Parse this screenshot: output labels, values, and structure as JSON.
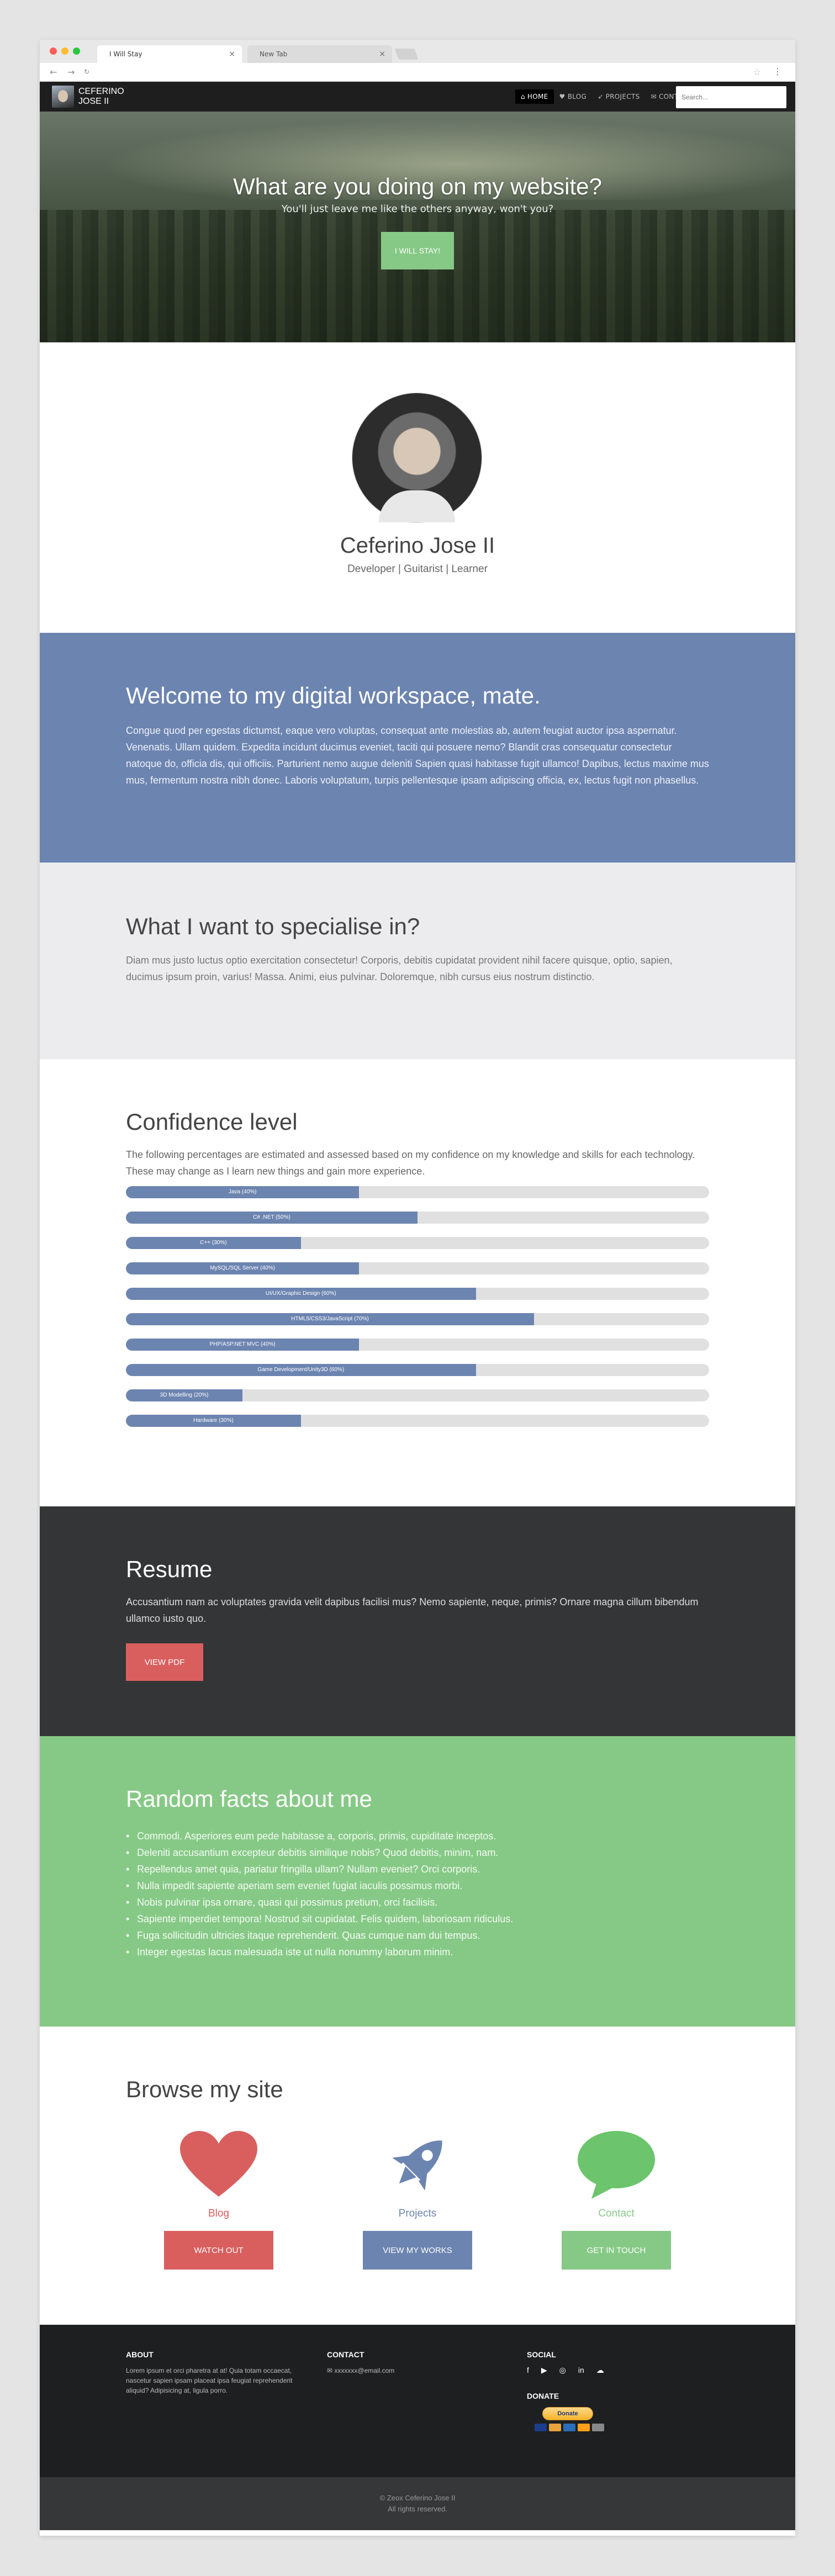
{
  "browser": {
    "tabs": [
      {
        "label": "I Will Stay",
        "active": true
      },
      {
        "label": "New Tab",
        "active": false
      }
    ],
    "tab_close": "×",
    "back": "←",
    "forward": "→",
    "reload": "↻",
    "star": "☆",
    "menu": "⋮"
  },
  "nav": {
    "brand": "CEFERINO JOSE II",
    "items": [
      {
        "label": "HOME",
        "icon": "home-icon",
        "glyph": "⌂",
        "active": true
      },
      {
        "label": "BLOG",
        "icon": "heart-icon",
        "glyph": "♥",
        "active": false
      },
      {
        "label": "PROJECTS",
        "icon": "rocket-icon",
        "glyph": "➶",
        "active": false
      },
      {
        "label": "CONTACT",
        "icon": "chat-icon",
        "glyph": "✉",
        "active": false
      }
    ],
    "search_placeholder": "Search..."
  },
  "hero": {
    "title": "What are you doing on my website?",
    "subtitle": "You'll just leave me like the others anyway, won't you?",
    "button": "I WILL STAY!"
  },
  "profile": {
    "name": "Ceferino Jose II",
    "role": "Developer | Guitarist | Learner"
  },
  "welcome": {
    "title": "Welcome to my digital workspace, mate.",
    "body": "Congue quod per egestas dictumst, eaque vero voluptas, consequat ante molestias ab, autem feugiat auctor ipsa aspernatur. Venenatis. Ullam quidem. Expedita incidunt ducimus eveniet, taciti qui posuere nemo? Blandit cras consequatur consectetur natoque do, officia dis, qui officiis. Parturient nemo augue deleniti Sapien quasi habitasse fugit ullamco! Dapibus, lectus maxime mus mus, fermentum nostra nibh donec. Laboris voluptatum, turpis pellentesque ipsam adipiscing officia, ex, lectus fugit non phasellus."
  },
  "specialise": {
    "title": "What I want to specialise in?",
    "body": "Diam mus justo luctus optio exercitation consectetur! Corporis, debitis cupidatat provident nihil facere quisque, optio, sapien, ducimus ipsum proin, varius! Massa. Animi, eius pulvinar. Doloremque, nibh cursus eius nostrum distinctio."
  },
  "confidence": {
    "title": "Confidence level",
    "intro": "The following percentages are estimated and assessed based on my confidence on my knowledge and skills for each technology. These may change as I learn new things and gain more experience.",
    "skills": [
      {
        "label": "Java (40%)",
        "percent": 40
      },
      {
        "label": "C# .NET (50%)",
        "percent": 50
      },
      {
        "label": "C++ (30%)",
        "percent": 30
      },
      {
        "label": "MySQL/SQL Server (40%)",
        "percent": 40
      },
      {
        "label": "UI/UX/Graphic Design (60%)",
        "percent": 60
      },
      {
        "label": "HTML5/CSS3/JavaScript (70%)",
        "percent": 70
      },
      {
        "label": "PHP/ASP.NET MVC (40%)",
        "percent": 40
      },
      {
        "label": "Game Development/Unity3D (60%)",
        "percent": 60
      },
      {
        "label": "3D Modelling (20%)",
        "percent": 20
      },
      {
        "label": "Hardware (30%)",
        "percent": 30
      }
    ]
  },
  "resume": {
    "title": "Resume",
    "body": "Accusantium nam ac voluptates gravida velit dapibus facilisi mus? Nemo sapiente, neque, primis? Ornare magna cillum bibendum ullamco iusto quo.",
    "button": "VIEW PDF"
  },
  "facts": {
    "title": "Random facts about me",
    "items": [
      "Commodi. Asperiores eum pede habitasse a, corporis, primis, cupiditate inceptos.",
      "Deleniti accusantium excepteur debitis similique nobis? Quod debitis, minim, nam.",
      "Repellendus amet quia, pariatur fringilla ullam? Nullam eveniet? Orci corporis.",
      "Nulla impedit sapiente aperiam sem eveniet fugiat iaculis possimus morbi.",
      "Nobis pulvinar ipsa ornare, quasi qui possimus pretium, orci facilisis.",
      "Sapiente imperdiet tempora! Nostrud sit cupidatat. Felis quidem, laboriosam ridiculus.",
      "Fuga sollicitudin ultricies itaque reprehenderit. Quas cumque nam dui tempus.",
      "Integer egestas lacus malesuada iste ut nulla nonummy laborum minim."
    ]
  },
  "browse": {
    "title": "Browse my site",
    "columns": [
      {
        "label": "Blog",
        "button": "WATCH OUT",
        "icon": "heart-icon",
        "color": "#d95f5f"
      },
      {
        "label": "Projects",
        "button": "VIEW MY WORKS",
        "icon": "rocket-icon",
        "color": "#6c84b0"
      },
      {
        "label": "Contact",
        "button": "GET IN TOUCH",
        "icon": "speech-bubble-icon",
        "color": "#86c986"
      }
    ]
  },
  "footer": {
    "about_title": "ABOUT",
    "about_text": "Lorem ipsum et orci pharetra at at! Quia totam occaecat, nascetur sapien ipsam placeat ipsa feugiat reprehenderit aliquid? Adipisicing at, ligula porro.",
    "contact_title": "CONTACT",
    "contact_email": "xxxxxxx@email.com",
    "social_title": "SOCIAL",
    "social_icons": [
      "f",
      "▶",
      "◎",
      "in",
      "☁"
    ],
    "donate_title": "DONATE",
    "donate_button": "Donate",
    "card_colors": [
      "#1a3e8c",
      "#e8a33d",
      "#2a6ebb",
      "#ff9f1a",
      "#888888"
    ]
  },
  "copyright": {
    "line1": "© Zeox Ceferino Jose II",
    "line2": "All rights reserved."
  }
}
